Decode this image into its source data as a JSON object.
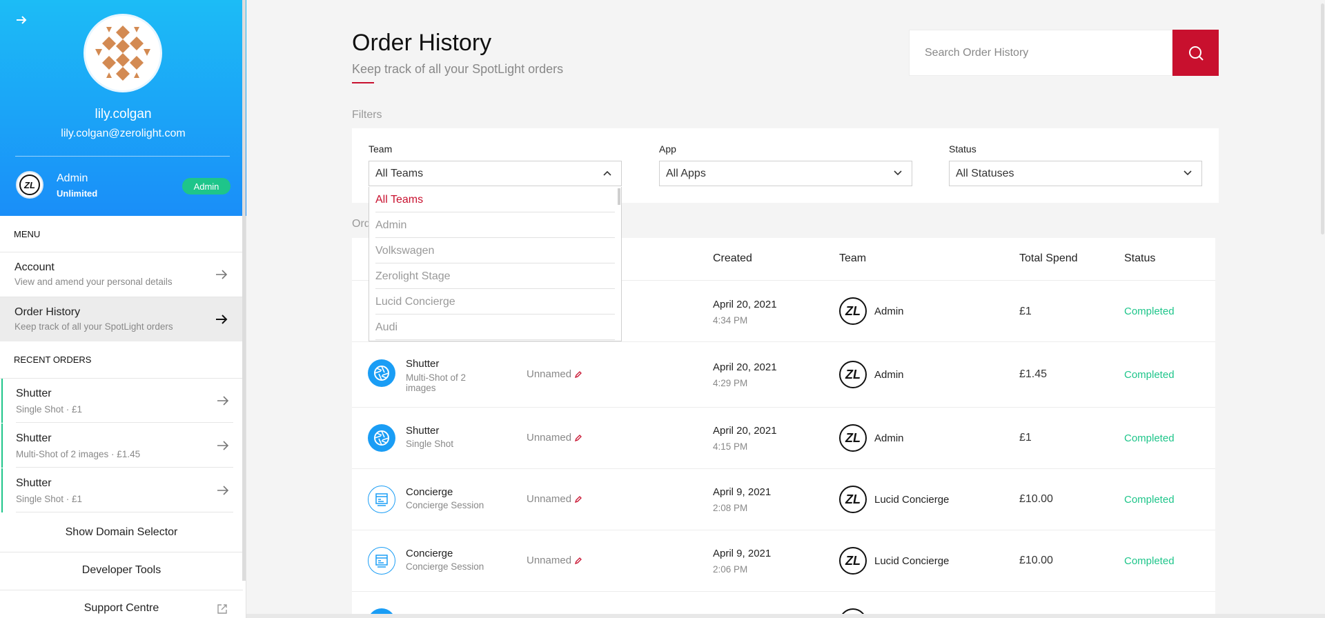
{
  "profile": {
    "username": "lily.colgan",
    "email": "lily.colgan@zerolight.com",
    "team_logo_text": "ZL",
    "team_name": "Admin",
    "team_plan": "Unlimited",
    "team_badge": "Admin"
  },
  "sidebar": {
    "menu_head": "MENU",
    "menu": [
      {
        "title": "Account",
        "subtitle": "View and amend your personal details"
      },
      {
        "title": "Order History",
        "subtitle": "Keep track of all your SpotLight orders"
      }
    ],
    "recent_head": "RECENT ORDERS",
    "recent": [
      {
        "title": "Shutter",
        "subtitle": "Single Shot · £1"
      },
      {
        "title": "Shutter",
        "subtitle": "Multi-Shot of 2 images · £1.45"
      },
      {
        "title": "Shutter",
        "subtitle": "Single Shot · £1"
      }
    ],
    "buttons": {
      "domain": "Show Domain Selector",
      "devtools": "Developer Tools",
      "support": "Support Centre"
    }
  },
  "header": {
    "title": "Order History",
    "subtitle": "Keep track of all your SpotLight orders",
    "search_placeholder": "Search Order History"
  },
  "filters": {
    "label": "Filters",
    "team": {
      "label": "Team",
      "value": "All Teams"
    },
    "app": {
      "label": "App",
      "value": "All Apps"
    },
    "status": {
      "label": "Status",
      "value": "All Statuses"
    },
    "team_options": [
      "All Teams",
      "Admin",
      "Volkswagen",
      "Zerolight Stage",
      "Lucid Concierge",
      "Audi"
    ]
  },
  "orders": {
    "label": "Ord",
    "columns": {
      "created": "Created",
      "team": "Team",
      "spend": "Total Spend",
      "status": "Status"
    },
    "rows": [
      {
        "app": "",
        "desc": "",
        "name": "",
        "date": "April 20, 2021",
        "time": "4:34 PM",
        "team_logo": "ZL",
        "team": "Admin",
        "spend": "£1",
        "status": "Completed"
      },
      {
        "app": "Shutter",
        "desc": "Multi-Shot of 2 images",
        "name": "Unnamed",
        "date": "April 20, 2021",
        "time": "4:29 PM",
        "team_logo": "ZL",
        "team": "Admin",
        "spend": "£1.45",
        "status": "Completed"
      },
      {
        "app": "Shutter",
        "desc": "Single Shot",
        "name": "Unnamed",
        "date": "April 20, 2021",
        "time": "4:15 PM",
        "team_logo": "ZL",
        "team": "Admin",
        "spend": "£1",
        "status": "Completed"
      },
      {
        "app": "Concierge",
        "desc": "Concierge Session",
        "name": "Unnamed",
        "date": "April 9, 2021",
        "time": "2:08 PM",
        "team_logo": "ZL",
        "team": "Lucid Concierge",
        "spend": "£10.00",
        "status": "Completed"
      },
      {
        "app": "Concierge",
        "desc": "Concierge Session",
        "name": "Unnamed",
        "date": "April 9, 2021",
        "time": "2:06 PM",
        "team_logo": "ZL",
        "team": "Lucid Concierge",
        "spend": "£10.00",
        "status": "Completed"
      }
    ]
  },
  "colors": {
    "accent_red": "#c8102e",
    "status_green": "#1ec58a",
    "sidebar_blue": "#1a9df5"
  }
}
